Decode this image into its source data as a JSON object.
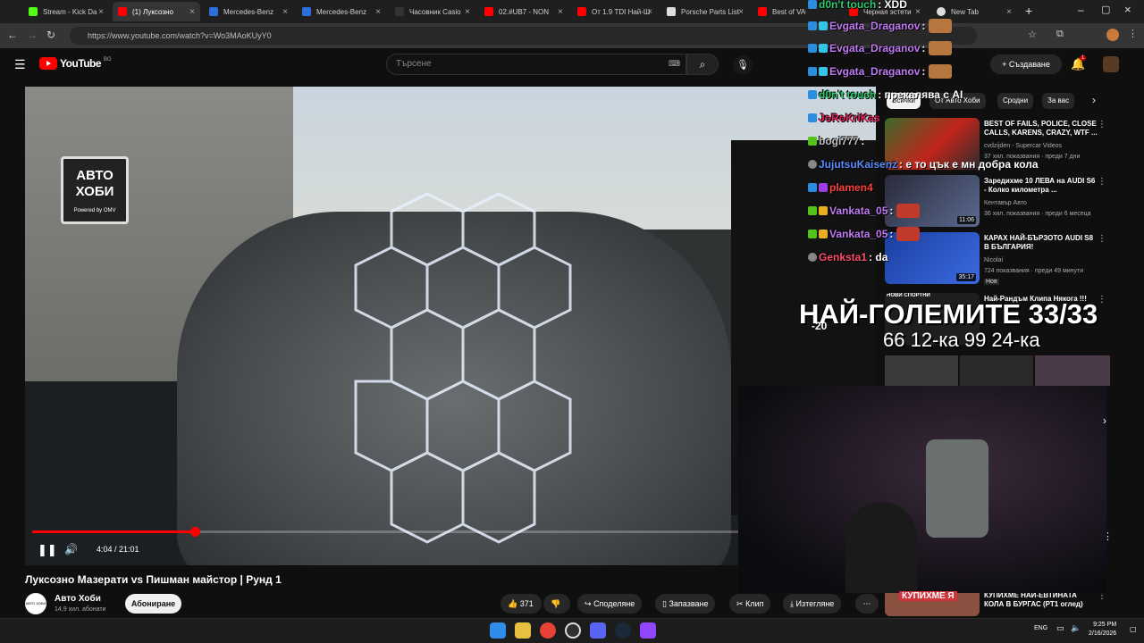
{
  "browser": {
    "tabs": [
      {
        "title": "Stream - Kick Da",
        "color": "#53fc18",
        "active": false
      },
      {
        "title": "(1) Луксозно",
        "color": "#ff0000",
        "active": true
      },
      {
        "title": "Mercedes-Benz",
        "color": "#2a6fdb",
        "active": false
      },
      {
        "title": "Mercedes-Benz",
        "color": "#2a6fdb",
        "active": false
      },
      {
        "title": "Часовник Casio",
        "color": "#333333",
        "active": false
      },
      {
        "title": "02.#UB7 - NON",
        "color": "#ff0000",
        "active": false
      },
      {
        "title": "От 1.9 TDI Най-Ш",
        "color": "#ff0000",
        "active": false
      },
      {
        "title": "Porsche Parts List",
        "color": "#dddddd",
        "active": false
      },
      {
        "title": "Best of VAG Cars",
        "color": "#ff0000",
        "active": false
      },
      {
        "title": "Черная эстети",
        "color": "#ff0000",
        "active": false
      },
      {
        "title": "New Tab",
        "color": "#dddddd",
        "active": false
      }
    ],
    "url": "https://www.youtube.com/watch?v=Wo3MAoKUyY0"
  },
  "youtube": {
    "logo_text": "YouTube",
    "logo_country": "BG",
    "search_placeholder": "Търсене",
    "create_label": "Създаване",
    "notif_count": "1"
  },
  "video": {
    "time": "4:04 / 21:01",
    "progress": 0.194,
    "title": "Луксозно Мазерати vs Пишман майстор | Рунд 1",
    "channel": "Авто Хоби",
    "subscribers": "14,9 хил. абонати",
    "subscribe_label": "Абониране",
    "likes": "371",
    "share_label": "Споделяне",
    "save_label": "Запазване",
    "clip_label": "Клип",
    "download_label": "Изтегляне",
    "sign_text": "АВТО ХОБИ",
    "sign_powered": "Powered by OMV"
  },
  "chips": [
    "Всички",
    "От Авто Хоби",
    "Сродни",
    "За вас"
  ],
  "recommendations": [
    {
      "title": "BEST OF FAILS, POLICE, CLOSE CALLS, KARENS, CRAZY, WTF ...",
      "channel": "cvdzijden - Supercar Videos",
      "meta": "37 хил. показвания · преди 7 дни",
      "duration": "",
      "thumb": "#7a2a22"
    },
    {
      "title": "Заредихме 10 ЛЕВА на AUDI S6 - Колко километра ...",
      "channel": "Кентавър Авто",
      "meta": "36 хил. показвания · преди 6 месеца",
      "duration": "11:06",
      "thumb": "#3a3f58"
    },
    {
      "title": "КАРАХ НАЙ-БЪРЗОТО AUDI S8 В БЪЛГАРИЯ!",
      "channel": "Nicolai",
      "meta": "724 показвания · преди 49 минути",
      "badge": "Нов",
      "duration": "35:17",
      "thumb": "#1f4aa8"
    },
    {
      "title": "Най-Рандъм Клипа Някога !!!",
      "channel": "",
      "meta": "",
      "duration": "",
      "thumb": "#2a2a2a"
    },
    {
      "title": "КУПИХМЕ НАЙ-ЕВТИНАТА КОЛА В БУРГАС (РТ1 оглед)",
      "channel": "",
      "meta": "",
      "duration": "",
      "thumb": "#44403a"
    }
  ],
  "chat": [
    {
      "nick": "d0n't touch",
      "msg": ": XDD",
      "color": "#2ecc71"
    },
    {
      "nick": "Evgata_Draganov",
      "msg": ":",
      "color": "#c17cf5"
    },
    {
      "nick": "Evgata_Draganov",
      "msg": ":",
      "color": "#c17cf5"
    },
    {
      "nick": "Evgata_Draganov",
      "msg": ":",
      "color": "#c17cf5"
    },
    {
      "nick": "d0n't touch",
      "msg": ": прекалява с AI",
      "color": "#2ecc71"
    },
    {
      "nick": "JoRoKriKas",
      "msg": "",
      "color": "#e0245e"
    },
    {
      "nick": "bogi777",
      "msg": ":",
      "color": "#c0c0c0"
    },
    {
      "nick": "JujutsuKaisenz",
      "msg": ": е то цък е мн добра кола",
      "color": "#5b8cff"
    },
    {
      "nick": "plamen4",
      "msg": "",
      "color": "#ff4040"
    },
    {
      "nick": "Vankata_05",
      "msg": ":",
      "color": "#c17cf5"
    },
    {
      "nick": "Vankata_05",
      "msg": ":",
      "color": "#c17cf5"
    },
    {
      "nick": "Genksta1",
      "msg": ": da",
      "color": "#ff4f6d"
    }
  ],
  "overlay": {
    "big_title": "НАЙ-ГОЛЕМИТЕ 33/33",
    "subline": "66 12-ка 99 24-ка",
    "kupihme": "КУПИХМЕ Я",
    "new_sport": "НОВИ СПОРТНИ",
    "minus": "-20"
  },
  "taskbar": {
    "lang": "ENG",
    "time": "9:25 PM",
    "date": "2/16/2026"
  }
}
